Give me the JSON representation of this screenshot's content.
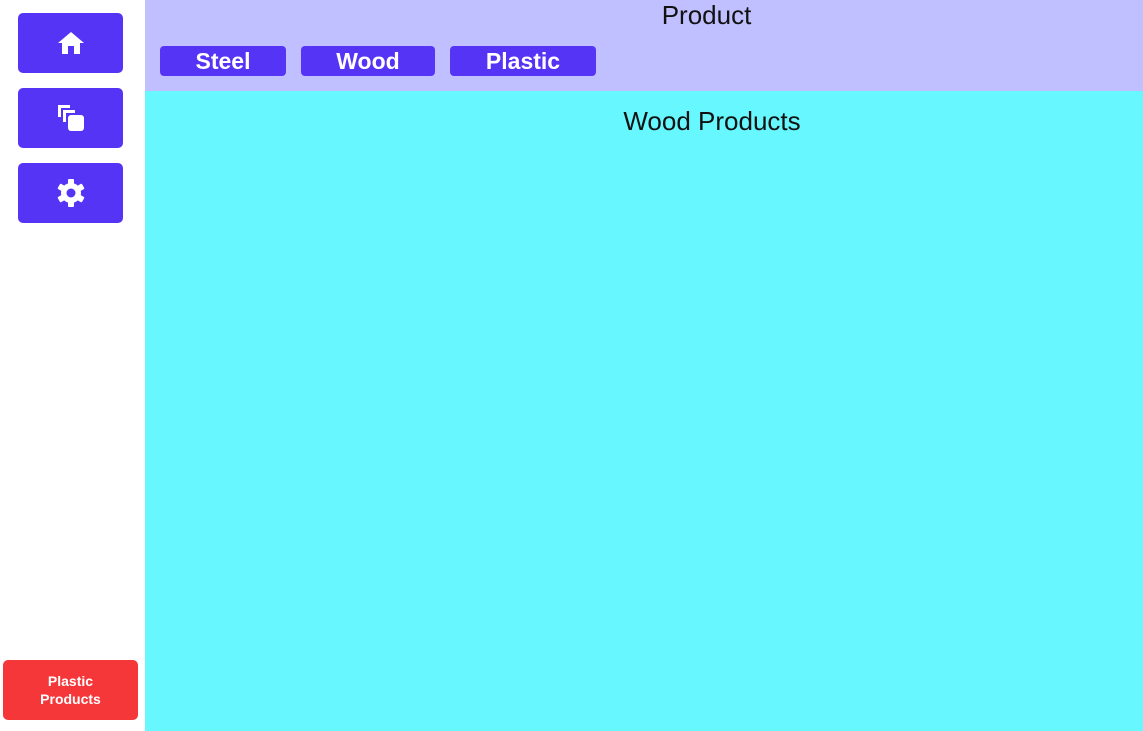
{
  "sidebar": {
    "nav": [
      {
        "icon": "home-icon"
      },
      {
        "icon": "pages-icon"
      },
      {
        "icon": "gear-icon"
      }
    ],
    "bottom_button": {
      "line1": "Plastic",
      "line2": "Products",
      "color": "#f5373a"
    }
  },
  "header": {
    "title": "Product",
    "categories": [
      {
        "label": "Steel"
      },
      {
        "label": "Wood"
      },
      {
        "label": "Plastic"
      }
    ],
    "background": "#c0bfff"
  },
  "main": {
    "title": "Wood Products",
    "background": "#66f7ff"
  },
  "colors": {
    "accent": "#5634f5"
  }
}
